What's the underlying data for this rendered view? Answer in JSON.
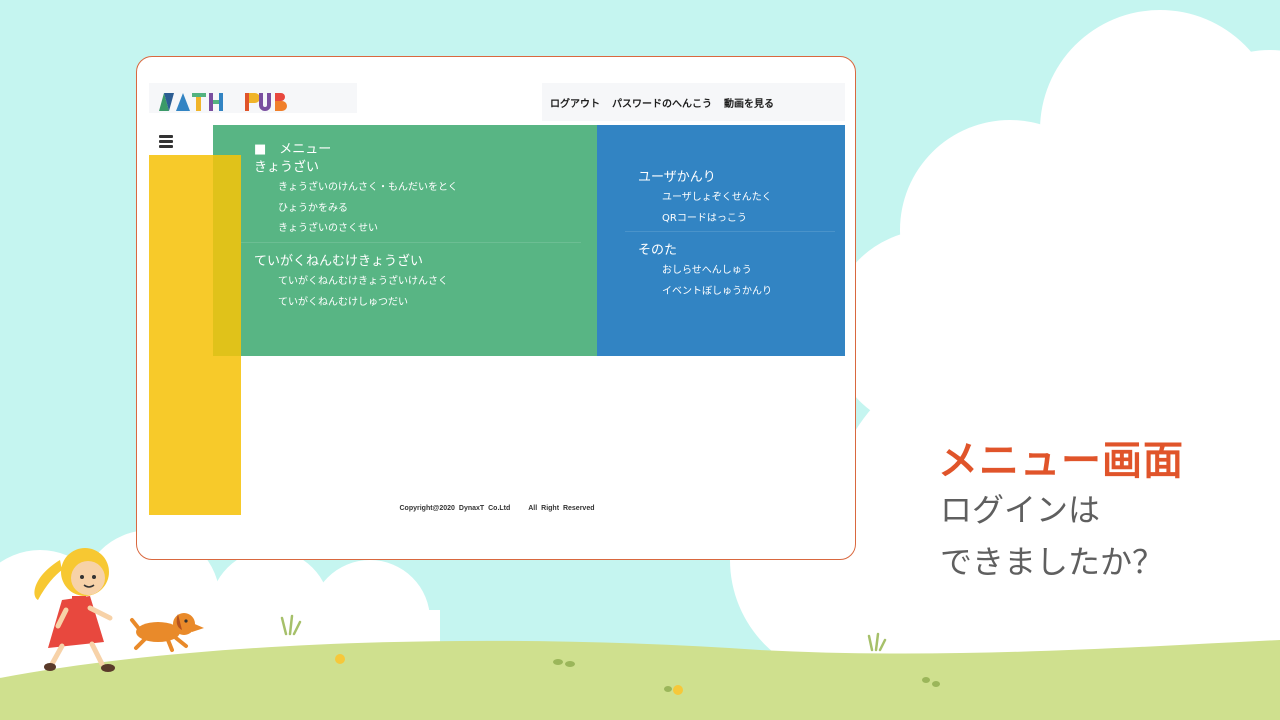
{
  "logo": {
    "text": "MATH PUB"
  },
  "topnav": {
    "logout": "ログアウト",
    "password_change": "パスワードのへんこう",
    "watch_video": "動画を見る"
  },
  "menu": {
    "heading": "■　メニュー",
    "kyouzai": {
      "title": "きょうざい",
      "items": [
        "きょうざいのけんさく・もんだいをとく",
        "ひょうかをみる",
        "きょうざいのさくせい"
      ]
    },
    "teigaku": {
      "title": "ていがくねんむけきょうざい",
      "items": [
        "ていがくねんむけきょうざいけんさく",
        "ていがくねんむけしゅつだい"
      ]
    },
    "user": {
      "title": "ユーザかんり",
      "items": [
        "ユーザしょぞくせんたく",
        "QRコードはっこう"
      ]
    },
    "other": {
      "title": "そのた",
      "items": [
        "おしらせへんしゅう",
        "イベントぼしゅうかんり"
      ]
    }
  },
  "footer": {
    "copyright": "Copyright@2020 DynaxT Co.Ltd",
    "rights": "All Right Reserved"
  },
  "caption": {
    "title": "メニュー画面",
    "line1": "ログインは",
    "line2": "できましたか？"
  },
  "colors": {
    "sky": "#c5f5f0",
    "grass": "#cfe08e",
    "accent": "#e0542a",
    "menu_green": "#53b380",
    "menu_blue": "#3284c3",
    "sidebar_yellow": "#f7ca2a"
  }
}
